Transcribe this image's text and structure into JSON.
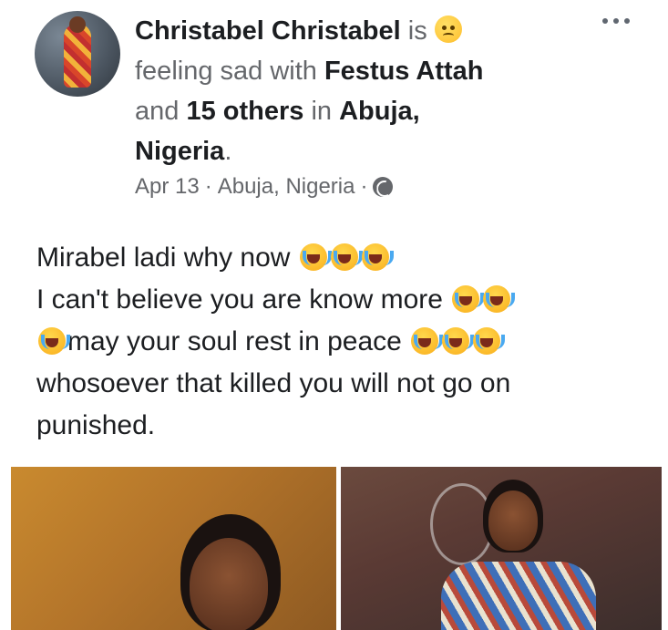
{
  "post": {
    "author": "Christabel Christabel",
    "is_word": "is",
    "feeling_text": "feeling sad with",
    "tagged_person": "Festus Attah",
    "and_word": "and",
    "others_text": "15 others",
    "in_word": "in",
    "location_bold_1": "Abuja,",
    "location_bold_2": "Nigeria",
    "period": ".",
    "meta": {
      "date": "Apr 13",
      "separator": "·",
      "location": "Abuja, Nigeria",
      "separator2": "·"
    },
    "body_lines": {
      "line1": "Mirabel ladi why now",
      "line2": "I can't believe you are know more",
      "line3": "may your soul rest in peace",
      "line4": "whosoever that killed you will not go on",
      "line5": "punished."
    }
  },
  "icons": {
    "feeling_emoji": "sad-face-emoji",
    "crying_emoji": "loudly-crying-face-emoji",
    "privacy": "globe-icon",
    "menu": "more-options-icon"
  },
  "colors": {
    "primary_text": "#1c1e21",
    "secondary_text": "#65676b"
  }
}
